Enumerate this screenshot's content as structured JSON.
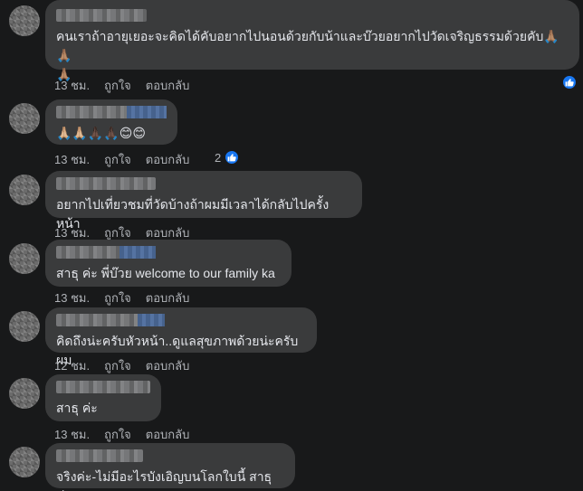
{
  "comments": [
    {
      "text": "คนเราถ้าอายุเยอะจะคิดได้คับอยากไปนอนด้วยกับน้าและบ๊วยอยากไปวัดเจริญธรรมด้วยคับ🙏🏽🙏🏽\n🙏🏽",
      "time": "13 ชม.",
      "like": "ถูกใจ",
      "reply": "ตอบกลับ",
      "reaction_count": ""
    },
    {
      "text": "🙏🏼🙏🏼🙏🏿🙏🏿😊😊",
      "time": "13 ชม.",
      "like": "ถูกใจ",
      "reply": "ตอบกลับ",
      "reaction_count": "2"
    },
    {
      "text": "อยากไปเที่ยวชมที่วัดบ้างถ้าผมมีเวลาได้กลับไปครั้งหน้า",
      "time": "13 ชม.",
      "like": "ถูกใจ",
      "reply": "ตอบกลับ",
      "reaction_count": ""
    },
    {
      "text": "สาธุ ค่ะ พี่บ๊วย welcome to our family ka",
      "time": "13 ชม.",
      "like": "ถูกใจ",
      "reply": "ตอบกลับ",
      "reaction_count": ""
    },
    {
      "text": "คิดถึงน่ะครับหัวหน้า..ดูแลสุขภาพด้วยน่ะครับผม",
      "time": "12 ชม.",
      "like": "ถูกใจ",
      "reply": "ตอบกลับ",
      "reaction_count": ""
    },
    {
      "text": "สาธุ ค่ะ",
      "time": "13 ชม.",
      "like": "ถูกใจ",
      "reply": "ตอบกลับ",
      "reaction_count": ""
    },
    {
      "text": "จริงค่ะ-ไม่มีอะไรบังเอิญบนโลกใบนี้ สาธุค่ะ.",
      "time": "",
      "like": "",
      "reply": "",
      "reaction_count": ""
    }
  ],
  "colors": {
    "background": "#18191a",
    "bubble": "#3a3b3c",
    "text": "#e4e6eb",
    "meta": "#b0b3b8",
    "like_blue": "#1877f2"
  }
}
